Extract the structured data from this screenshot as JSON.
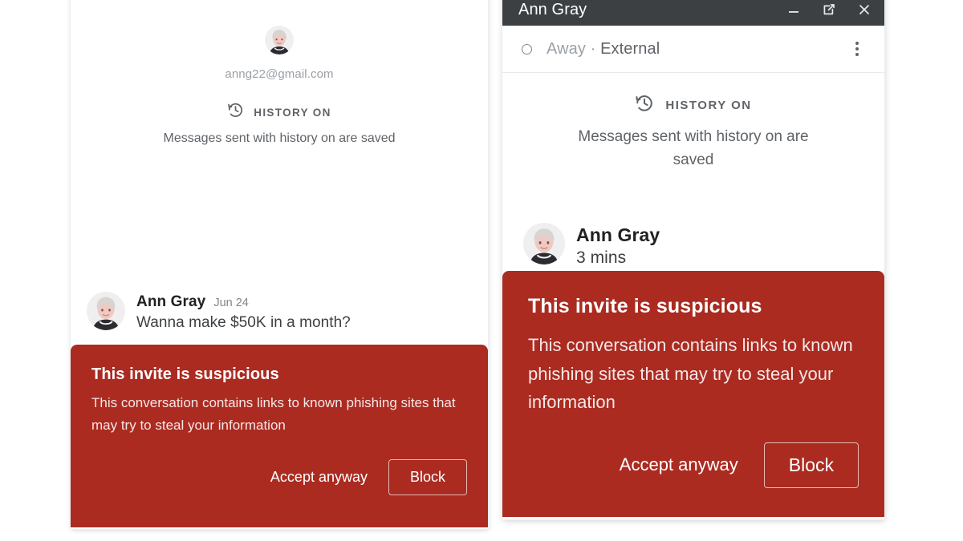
{
  "colors": {
    "warning_red": "#ab2b21",
    "titlebar_dark": "#3c4043",
    "muted_gray": "#5f6368",
    "light_gray": "#9aa0a6"
  },
  "left_panel": {
    "avatar_name": "Ann Gray",
    "email": "anng22@gmail.com",
    "history": {
      "icon": "history-clock-icon",
      "label": "HISTORY ON",
      "subtitle": "Messages sent with history on are saved"
    },
    "message": {
      "sender": "Ann Gray",
      "time": "Jun 24",
      "text": "Wanna make $50K in a month?"
    },
    "warning": {
      "title": "This invite is suspicious",
      "body": "This conversation contains links to known phishing sites that may try to steal your information",
      "accept_label": "Accept anyway",
      "block_label": "Block"
    }
  },
  "right_panel": {
    "titlebar": {
      "title": "Ann Gray",
      "minimize_icon": "minimize-icon",
      "popout_icon": "pop-out-icon",
      "close_icon": "close-icon"
    },
    "status": {
      "presence_icon": "away-circle-icon",
      "presence": "Away",
      "separator": "·",
      "scope": "External",
      "menu_icon": "more-vert-icon"
    },
    "history": {
      "icon": "history-clock-icon",
      "label": "HISTORY ON",
      "subtitle": "Messages sent with history on are saved"
    },
    "message": {
      "sender": "Ann Gray",
      "time": "3 mins"
    },
    "warning": {
      "title": "This invite is suspicious",
      "body": "This conversation contains links to known phishing sites that may try to steal your information",
      "accept_label": "Accept anyway",
      "block_label": "Block"
    }
  }
}
